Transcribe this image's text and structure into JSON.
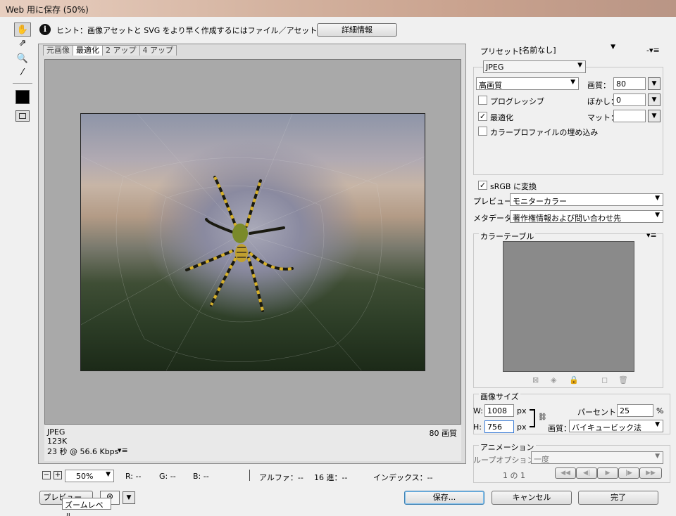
{
  "window": {
    "title": "Web 用に保存 (50%)"
  },
  "hint": {
    "text": "ヒント：画像アセットと SVG をより早く作成するにはファイル／アセットを抽出を選択",
    "details_button": "詳細情報"
  },
  "tabs": [
    {
      "label": "元画像"
    },
    {
      "label": "最適化"
    },
    {
      "label": "2 アップ"
    },
    {
      "label": "4 アップ"
    }
  ],
  "preview_info": {
    "format": "JPEG",
    "size": "123K",
    "time": "23 秒 @ 56.6 Kbps",
    "quality_label": "80 画質"
  },
  "settings": {
    "preset_label": "プリセット：",
    "preset_value": "[名前なし]",
    "format": "JPEG",
    "quality_level": "高画質",
    "quality_label": "画質：",
    "quality_value": "80",
    "progressive_label": "プログレッシブ",
    "progressive_checked": false,
    "blur_label": "ぼかし：",
    "blur_value": "0",
    "optimize_label": "最適化",
    "optimize_checked": true,
    "matte_label": "マット：",
    "matte_value": "",
    "embed_profile_label": "カラープロファイルの埋め込み",
    "embed_profile_checked": false,
    "srgb_label": "sRGB に変換",
    "srgb_checked": true,
    "preview_label": "プレビュー：",
    "preview_value": "モニターカラー",
    "metadata_label": "メタデータ：",
    "metadata_value": "著作権情報および問い合わせ先"
  },
  "color_table": {
    "title": "カラーテーブル"
  },
  "image_size": {
    "title": "画像サイズ",
    "w_label": "W:",
    "w_value": "1008",
    "h_label": "H:",
    "h_value": "756",
    "unit": "px",
    "percent_label": "パーセント：",
    "percent_value": "25",
    "percent_unit": "%",
    "quality_label": "画質：",
    "quality_value": "バイキュービック法"
  },
  "animation": {
    "title": "アニメーション",
    "loop_label": "ループオプション：",
    "loop_value": "一度",
    "frame_counter": "1 の 1"
  },
  "status": {
    "zoom": "50%",
    "r": "R: --",
    "g": "G: --",
    "b": "B: --",
    "alpha": "アルファ：--",
    "hex": "16 進：--",
    "index": "インデックス：--"
  },
  "buttons": {
    "preview": "プレビュー...",
    "save": "保存...",
    "cancel": "キャンセル",
    "done": "完了"
  },
  "tooltip": "ズームレベル"
}
